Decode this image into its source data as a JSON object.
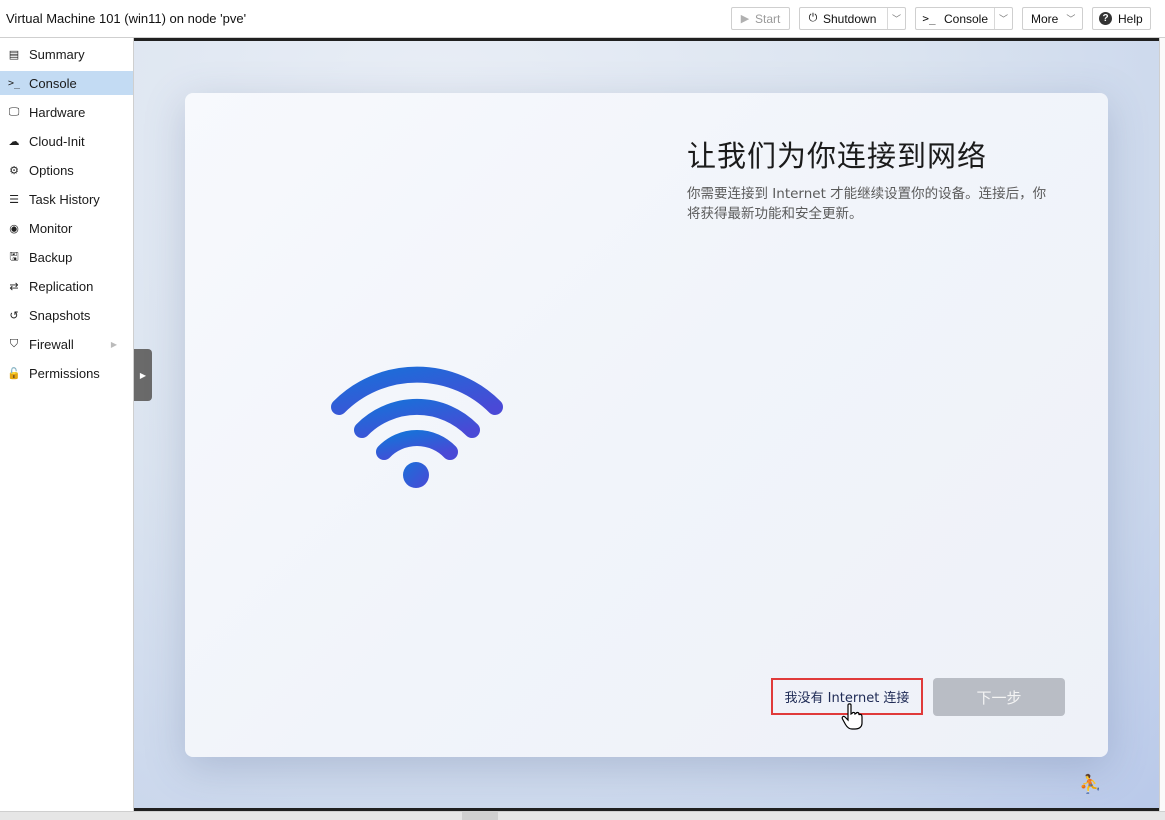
{
  "window": {
    "title": "Virtual Machine 101 (win11) on node 'pve'"
  },
  "toolbar": {
    "start_label": "Start",
    "shutdown_label": "Shutdown",
    "console_label": "Console",
    "more_label": "More",
    "help_label": "Help"
  },
  "sidebar": {
    "active": "Console",
    "items": [
      {
        "label": "Summary",
        "icon": "book-icon"
      },
      {
        "label": "Console",
        "icon": "terminal-icon"
      },
      {
        "label": "Hardware",
        "icon": "monitor-icon"
      },
      {
        "label": "Cloud-Init",
        "icon": "cloud-icon"
      },
      {
        "label": "Options",
        "icon": "gear-icon"
      },
      {
        "label": "Task History",
        "icon": "list-icon"
      },
      {
        "label": "Monitor",
        "icon": "eye-icon"
      },
      {
        "label": "Backup",
        "icon": "floppy-icon"
      },
      {
        "label": "Replication",
        "icon": "retweet-icon"
      },
      {
        "label": "Snapshots",
        "icon": "history-icon"
      },
      {
        "label": "Firewall",
        "icon": "shield-icon"
      },
      {
        "label": "Permissions",
        "icon": "unlock-icon"
      }
    ]
  },
  "setup": {
    "title": "让我们为你连接到网络",
    "description": "你需要连接到 Internet 才能继续设置你的设备。连接后，你将获得最新功能和安全更新。",
    "no_internet_label": "我没有 Internet 连接",
    "next_label": "下一步"
  },
  "colors": {
    "active_nav": "#c3dbf3",
    "wifi_gradient_start": "#1a6fd8",
    "wifi_gradient_end": "#4a49d6",
    "highlight_border": "#e03a3a",
    "next_disabled": "#b9bdc5"
  }
}
